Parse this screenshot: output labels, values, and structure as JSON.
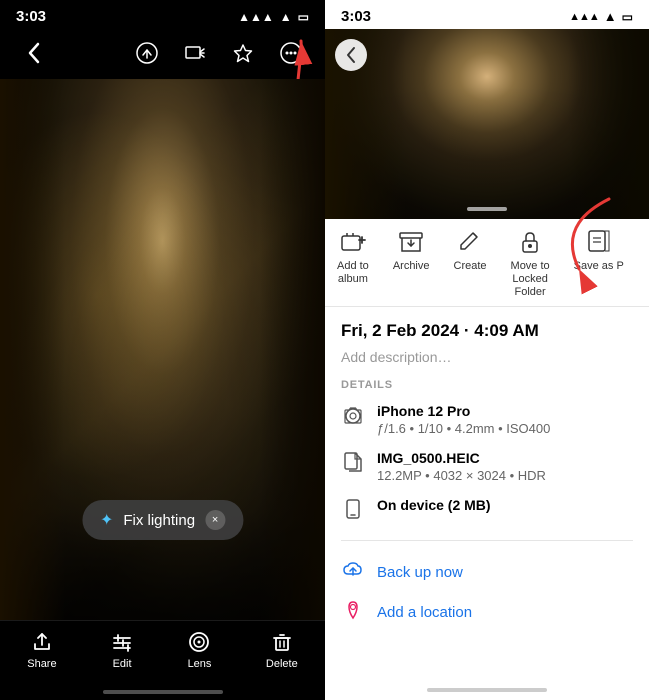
{
  "left": {
    "status_time": "3:03",
    "toolbar": {
      "back_icon": "‹",
      "upload_icon": "↑",
      "cast_icon": "⬜",
      "star_icon": "☆",
      "more_icon": "⊙"
    },
    "fix_lighting": {
      "label": "Fix lighting",
      "sparkle": "✦",
      "close": "×"
    },
    "bottom_buttons": [
      {
        "icon": "↑",
        "label": "Share"
      },
      {
        "icon": "⚙",
        "label": "Edit"
      },
      {
        "icon": "◎",
        "label": "Lens"
      },
      {
        "icon": "🗑",
        "label": "Delete"
      }
    ]
  },
  "right": {
    "status_time": "3:03",
    "back_button": "‹",
    "action_items": [
      {
        "icon": "≡+",
        "label": "Add to\nalbum"
      },
      {
        "icon": "⬇",
        "label": "Archive"
      },
      {
        "icon": "✏",
        "label": "Create"
      },
      {
        "icon": "🔒",
        "label": "Move to\nLocked\nFolder"
      },
      {
        "icon": "📄",
        "label": "Save as P"
      }
    ],
    "photo_date": "Fri, 2 Feb 2024",
    "photo_time": "4:09 AM",
    "add_description": "Add description…",
    "details_label": "DETAILS",
    "camera_model": "iPhone 12 Pro",
    "camera_settings": "ƒ/1.6  •  1/10  •  4.2mm  •  ISO400",
    "file_name": "IMG_0500.HEIC",
    "file_details": "12.2MP  •  4032 × 3024  •  HDR",
    "device_storage": "On device (2 MB)",
    "back_up_label": "Back up now",
    "add_location_label": "Add a location"
  }
}
